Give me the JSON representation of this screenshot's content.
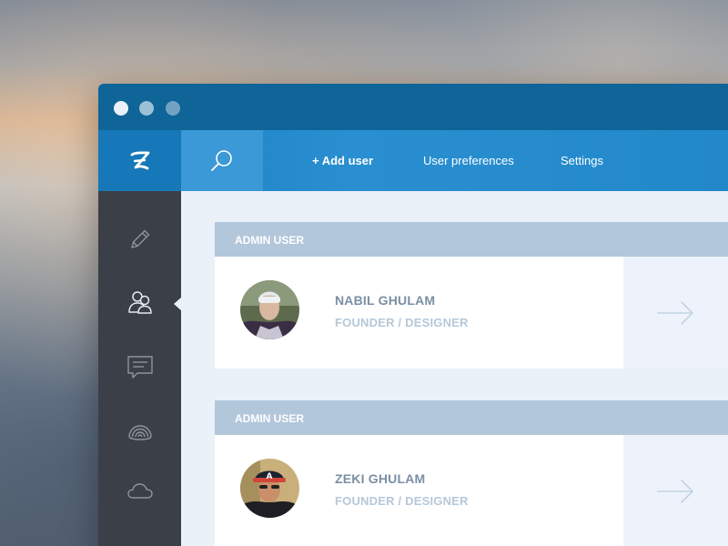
{
  "window": {
    "controls": [
      "close",
      "minimize",
      "maximize"
    ]
  },
  "navbar": {
    "logo_icon": "z-logo-icon",
    "search_icon": "search-icon",
    "links": [
      {
        "label": "+ Add user"
      },
      {
        "label": "User preferences"
      },
      {
        "label": "Settings"
      }
    ]
  },
  "sidebar": {
    "items": [
      {
        "icon": "pencil-icon",
        "active": false
      },
      {
        "icon": "users-icon",
        "active": true
      },
      {
        "icon": "chat-icon",
        "active": false
      },
      {
        "icon": "broadcast-icon",
        "active": false
      },
      {
        "icon": "cloud-icon",
        "active": false
      }
    ]
  },
  "users": [
    {
      "header": "ADMIN USER",
      "name": "NABIL GHULAM",
      "role": "FOUNDER / DESIGNER",
      "action_icon": "arrow-right-icon"
    },
    {
      "header": "ADMIN USER",
      "name": "ZEKI GHULAM",
      "role": "FOUNDER / DESIGNER",
      "action_icon": "arrow-right-icon"
    }
  ],
  "colors": {
    "titlebar": "#0f6498",
    "navbar": "#2188c9",
    "sidebar": "#3b3f47",
    "card_header": "#b3c7db",
    "content_bg": "#ebf1f8"
  }
}
